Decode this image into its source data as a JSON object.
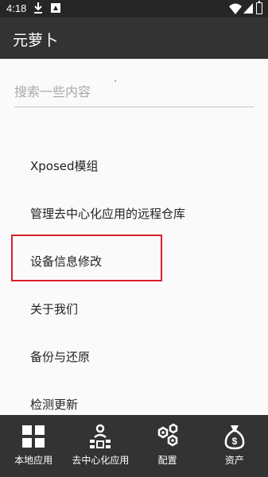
{
  "status_bar": {
    "time": "4:18"
  },
  "app_bar": {
    "title": "元萝卜"
  },
  "search": {
    "placeholder": "搜索一些内容",
    "value": ""
  },
  "menu": {
    "items": [
      {
        "label": "Xposed模组"
      },
      {
        "label": "管理去中心化应用的远程仓库"
      },
      {
        "label": "设备信息修改"
      },
      {
        "label": "关于我们"
      },
      {
        "label": "备份与还原"
      },
      {
        "label": "检测更新"
      }
    ]
  },
  "highlight_color": "#d8202a",
  "bottom_nav": {
    "items": [
      {
        "label": "本地应用",
        "icon": "grid-icon"
      },
      {
        "label": "去中心化应用",
        "icon": "decentralized-icon"
      },
      {
        "label": "配置",
        "icon": "hexagons-icon"
      },
      {
        "label": "资产",
        "icon": "money-bag-icon"
      }
    ]
  }
}
